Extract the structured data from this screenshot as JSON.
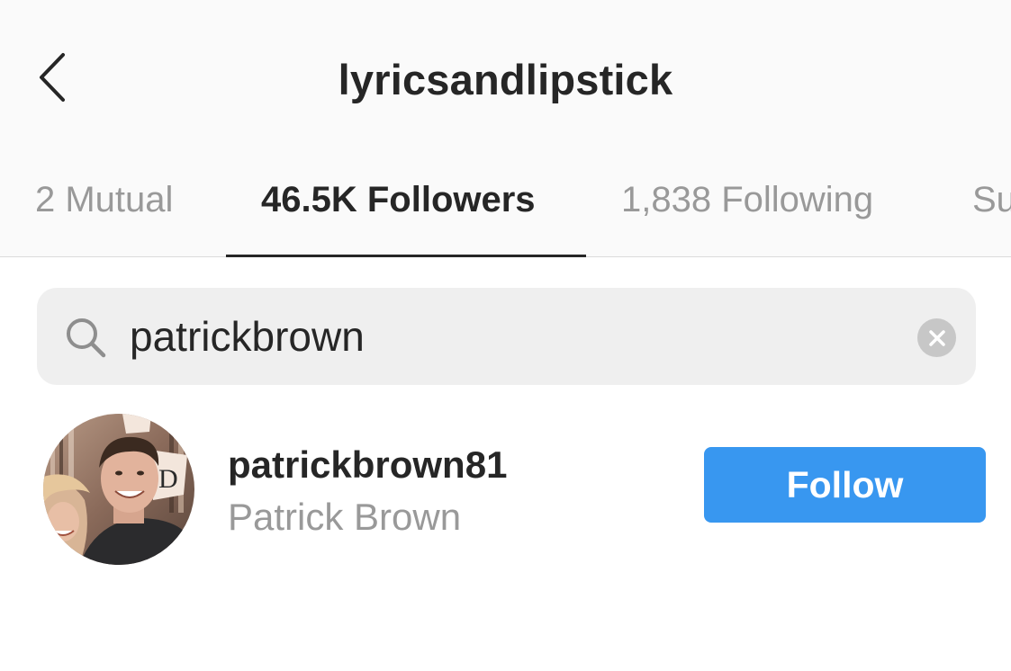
{
  "header": {
    "title": "lyricsandlipstick"
  },
  "tabs": [
    {
      "label": "2 Mutual",
      "active": false
    },
    {
      "label": "46.5K Followers",
      "active": true
    },
    {
      "label": "1,838 Following",
      "active": false
    },
    {
      "label": "Suggested",
      "active": false
    }
  ],
  "search": {
    "value": "patrickbrown"
  },
  "results": [
    {
      "username": "patrickbrown81",
      "full_name": "Patrick Brown",
      "button_label": "Follow"
    }
  ],
  "colors": {
    "accent": "#3897f0",
    "text_primary": "#262626",
    "text_secondary": "#999999",
    "header_bg": "#fafafa",
    "search_bg": "#efefef"
  },
  "icons": {
    "back": "chevron-left-icon",
    "search": "search-icon",
    "clear": "clear-icon"
  }
}
